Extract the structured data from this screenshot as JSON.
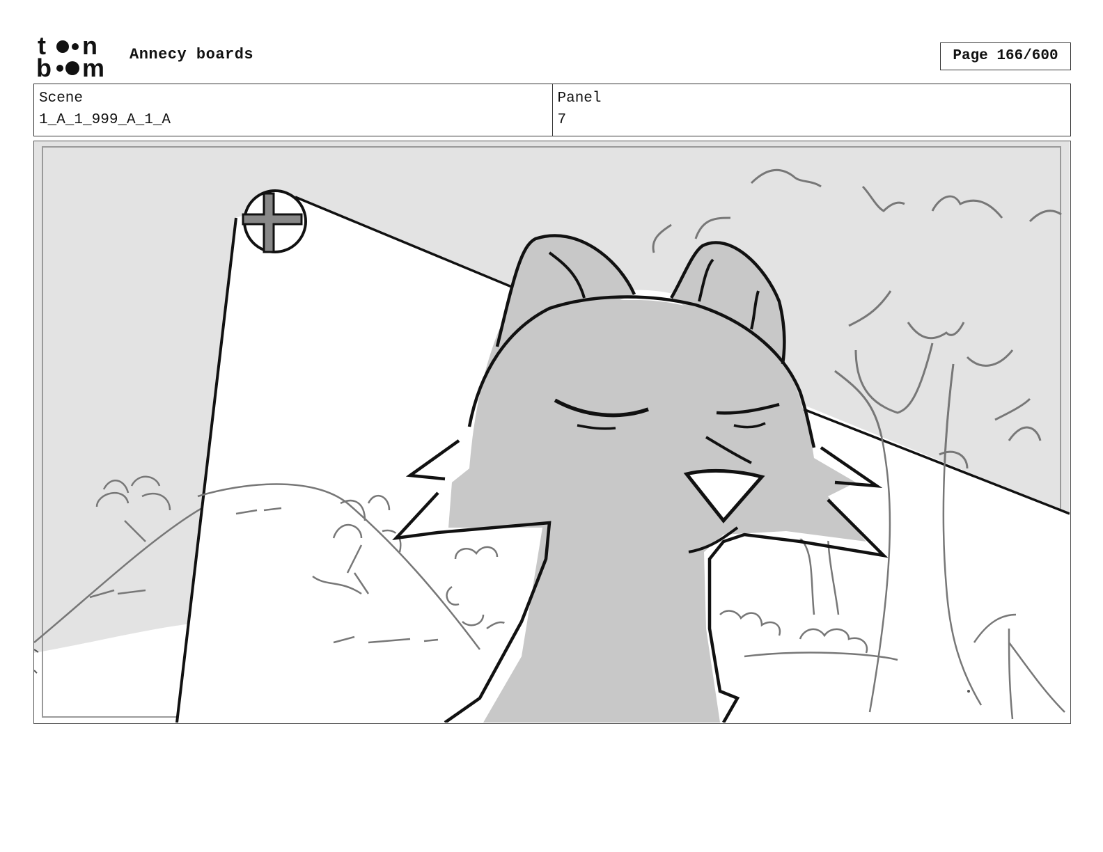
{
  "header": {
    "logo_text": "toon boom",
    "project_title": "Annecy boards",
    "page_label": "Page 166/600"
  },
  "info": {
    "scene_label": "Scene",
    "scene_value": "1_A_1_999_A_1_A",
    "panel_label": "Panel",
    "panel_value": "7"
  },
  "colors": {
    "sky": "#e3e3e3",
    "character_fill": "#c8c8c8",
    "ink": "#111111",
    "background_line": "#777777"
  }
}
